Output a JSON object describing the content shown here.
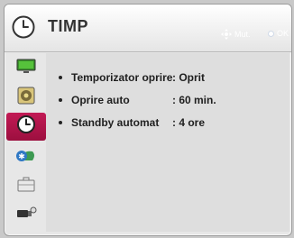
{
  "header": {
    "title": "TIMP",
    "icon": "clock-icon",
    "hint_move_label": "Mut.",
    "hint_ok_label": "OK"
  },
  "sidebar": {
    "items": [
      {
        "icon": "picture-icon",
        "active": false
      },
      {
        "icon": "audio-icon",
        "active": false
      },
      {
        "icon": "clock-icon",
        "active": true
      },
      {
        "icon": "network-icon",
        "active": false
      },
      {
        "icon": "toolbox-icon",
        "active": false
      },
      {
        "icon": "input-icon",
        "active": false
      }
    ]
  },
  "settings": [
    {
      "label": "Temporizator oprire",
      "value": ": Oprit"
    },
    {
      "label": "Oprire auto",
      "value": ": 60 min."
    },
    {
      "label": "Standby automat",
      "value": ": 4 ore"
    }
  ],
  "colors": {
    "active_tab": "#b0154a",
    "panel_bg": "#e7e7e7"
  }
}
